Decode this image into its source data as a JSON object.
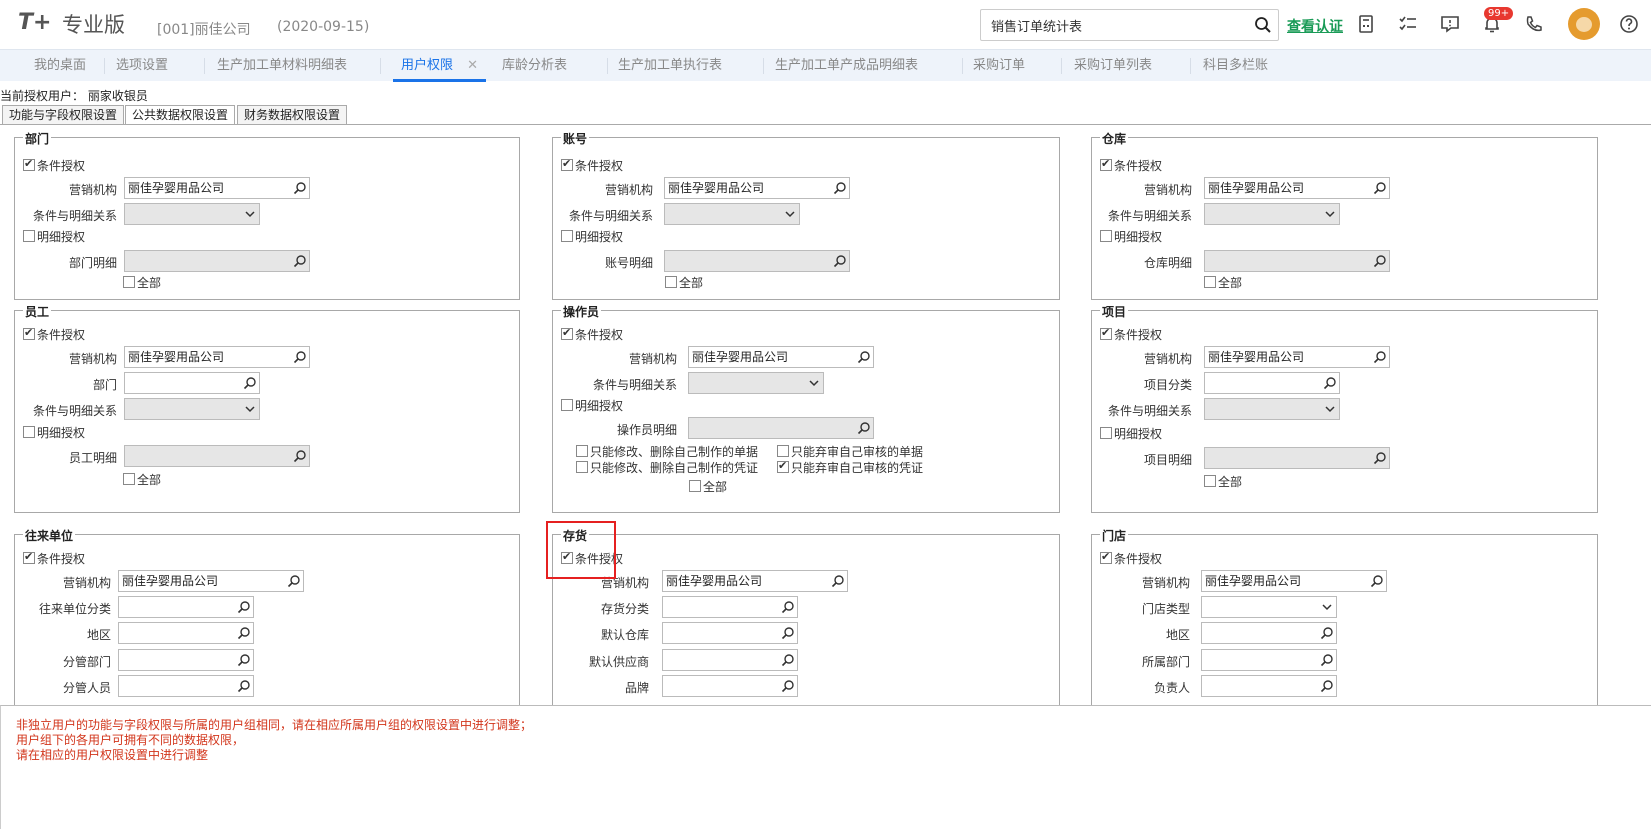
{
  "header": {
    "logo_main": "T+",
    "logo_sub": "专业版",
    "company": "[001]丽佳公司",
    "date": "(2020-09-15)",
    "search_value": "销售订单统计表",
    "verify_link": "查看认证",
    "notification_badge": "99+"
  },
  "tabs": [
    {
      "label": "我的桌面"
    },
    {
      "label": "选项设置"
    },
    {
      "label": "生产加工单材料明细表"
    },
    {
      "label": "用户权限",
      "active": true
    },
    {
      "label": "库龄分析表"
    },
    {
      "label": "生产加工单执行表"
    },
    {
      "label": "生产加工单产成品明细表"
    },
    {
      "label": "采购订单"
    },
    {
      "label": "采购订单列表"
    },
    {
      "label": "科目多栏账"
    }
  ],
  "tab_close": "✕",
  "current_user": {
    "label": "当前授权用户：",
    "value": "丽家收银员"
  },
  "subtabs": [
    {
      "label": "功能与字段权限设置"
    },
    {
      "label": "公共数据权限设置",
      "active": true
    },
    {
      "label": "财务数据权限设置"
    }
  ],
  "common": {
    "cond_auth": "条件授权",
    "detail_auth": "明细授权",
    "org_label": "营销机构",
    "org_value": "丽佳孕婴用品公司",
    "relation_label": "条件与明细关系",
    "all": "全部"
  },
  "panels": {
    "dept": {
      "title": "部门",
      "detail_label": "部门明细"
    },
    "account": {
      "title": "账号",
      "detail_label": "账号明细"
    },
    "warehouse": {
      "title": "仓库",
      "detail_label": "仓库明细"
    },
    "employee": {
      "title": "员工",
      "dept_label": "部门",
      "detail_label": "员工明细"
    },
    "operator": {
      "title": "操作员",
      "detail_label": "操作员明细",
      "opt1": "只能修改、删除自己制作的单据",
      "opt2": "只能弃审自己审核的单据",
      "opt3": "只能修改、删除自己制作的凭证",
      "opt4": "只能弃审自己审核的凭证"
    },
    "project": {
      "title": "项目",
      "category_label": "项目分类",
      "detail_label": "项目明细"
    },
    "partner": {
      "title": "往来单位",
      "category": "往来单位分类",
      "region": "地区",
      "dept": "分管部门",
      "person": "分管人员"
    },
    "inventory": {
      "title": "存货",
      "category": "存货分类",
      "warehouse": "默认仓库",
      "supplier": "默认供应商",
      "brand": "品牌"
    },
    "store": {
      "title": "门店",
      "type": "门店类型",
      "region": "地区",
      "dept": "所属部门",
      "manager": "负责人"
    }
  },
  "notice": {
    "line1": "非独立用户的功能与字段权限与所属的用户组相同，请在相应所属用户组的权限设置中进行调整；",
    "line2": "用户组下的各用户可拥有不同的数据权限，",
    "line3": "请在相应的用户权限设置中进行调整"
  }
}
